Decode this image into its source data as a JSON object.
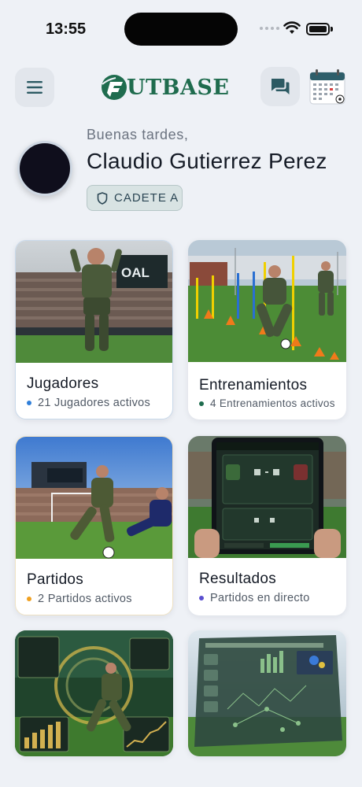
{
  "status_bar": {
    "time": "13:55"
  },
  "header": {
    "logo_text": "UTBASE"
  },
  "profile": {
    "greeting": "Buenas tardes,",
    "name": "Claudio Gutierrez Perez",
    "category": "CADETE A"
  },
  "cards": [
    {
      "title": "Jugadores",
      "subtitle": "21 Jugadores activos",
      "dot_color": "#2f7fd9"
    },
    {
      "title": "Entrenamientos",
      "subtitle": "4 Entrenamientos activos",
      "dot_color": "#1f6c4e"
    },
    {
      "title": "Partidos",
      "subtitle": "2 Partidos activos",
      "dot_color": "#f0a020"
    },
    {
      "title": "Resultados",
      "subtitle": "Partidos en directo",
      "dot_color": "#5a4fcf"
    },
    {
      "title": "",
      "subtitle": "",
      "dot_color": ""
    },
    {
      "title": "",
      "subtitle": "",
      "dot_color": ""
    }
  ],
  "colors": {
    "brand": "#1f6c4e",
    "background": "#eef1f6"
  },
  "icons": [
    "menu-icon",
    "chat-icon",
    "calendar-icon",
    "shield-icon"
  ]
}
